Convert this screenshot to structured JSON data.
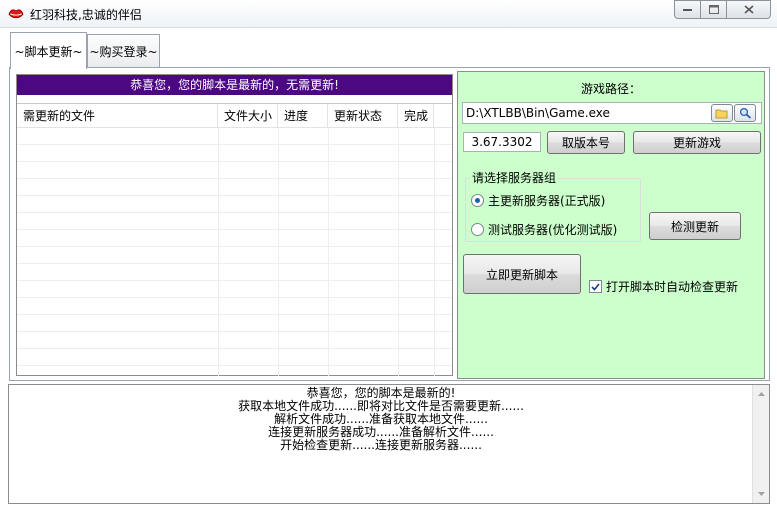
{
  "window": {
    "title": "红羽科技,忠诚的伴侣",
    "controls": [
      "minimize",
      "maximize",
      "close"
    ]
  },
  "tabs": [
    {
      "label": "~脚本更新~",
      "active": true
    },
    {
      "label": "~购买登录~",
      "active": false
    }
  ],
  "left": {
    "banner": "恭喜您，您的脚本是最新的，无需更新!",
    "banner_color": "#4b0882",
    "columns": [
      "需更新的文件",
      "文件大小",
      "进度",
      "更新状态",
      "完成"
    ],
    "rows": []
  },
  "right": {
    "path_label": "游戏路径：",
    "path_value": "D:\\XTLBB\\Bin\\Game.exe",
    "version_value": "3.67.3302",
    "get_version_button": "取版本号",
    "update_game_button": "更新游戏",
    "server_group_label": "请选择服务器组",
    "servers": [
      {
        "label": "主更新服务器(正式版)",
        "selected": true
      },
      {
        "label": "测试服务器(优化测试版)",
        "selected": false
      }
    ],
    "check_update_button": "检测更新",
    "update_now_button": "立即更新脚本",
    "auto_check_label": "打开脚本时自动检查更新",
    "auto_check": true,
    "panel_color": "#ccffcc"
  },
  "log": {
    "lines": [
      "恭喜您，您的脚本是最新的!",
      "获取本地文件成功......即将对比文件是否需要更新......",
      "解析文件成功......准备获取本地文件......",
      "连接更新服务器成功......准备解析文件......",
      "开始检查更新......连接更新服务器......"
    ]
  }
}
